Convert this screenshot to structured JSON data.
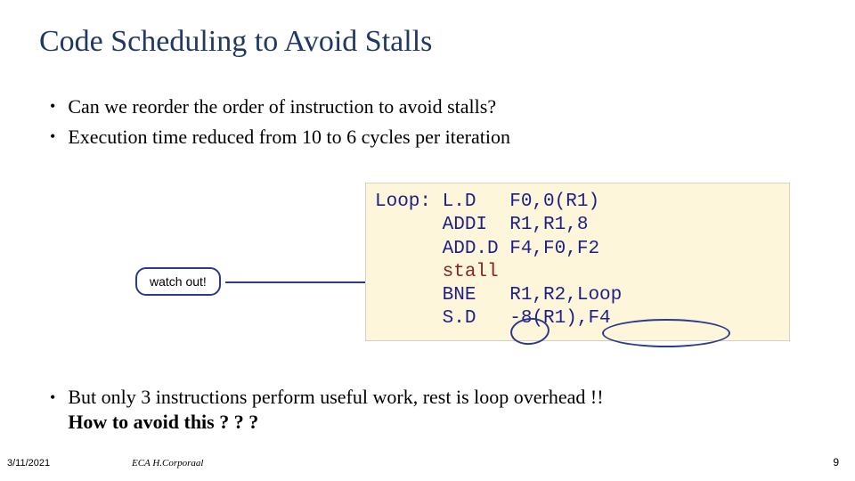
{
  "title": "Code Scheduling to Avoid Stalls",
  "bullet1": "Can we reorder the order of instruction to avoid stalls?",
  "bullet2": "Execution time reduced from 10 to 6 cycles per iteration",
  "code": {
    "l1": "Loop: L.D   F0,0(R1)",
    "l2": "      ADDI  R1,R1,8",
    "l3": "      ADD.D F4,F0,F2",
    "l4": "      stall",
    "l5": "      BNE   R1,R2,Loop",
    "l6": "      S.D   -8(R1),F4"
  },
  "watch": "watch out!",
  "bullet3a": "But only 3 instructions perform useful work, rest is loop overhead !!",
  "bullet3b": "How to avoid this ? ? ?",
  "footer": {
    "date": "3/11/2021",
    "author": "ECA  H.Corporaal",
    "page": "9"
  }
}
